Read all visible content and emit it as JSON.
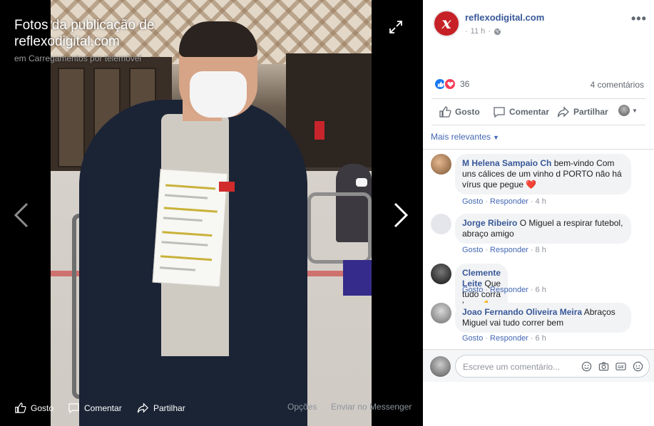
{
  "viewer": {
    "title": "Fotos da publicação de reflexodigital.com",
    "sub_prefix": "em",
    "album": "Carregamentos por telemóvel",
    "bar": {
      "like": "Gosto",
      "comment": "Comentar",
      "share": "Partilhar",
      "options": "Opções",
      "messenger": "Enviar no Messenger"
    }
  },
  "post": {
    "page_name": "reflexodigital.com",
    "avatar_letter": "x",
    "time": "11 h",
    "reaction_count": "36",
    "comments_count": "4 comentários",
    "actions": {
      "like": "Gosto",
      "comment": "Comentar",
      "share": "Partilhar"
    },
    "sort_label": "Mais relevantes"
  },
  "comments": [
    {
      "name": "M Helena Sampaio Ch",
      "text": "bem-vindo Com uns cálices de um vinho d PORTO não há vírus que pegue ❤️",
      "like": "Gosto",
      "reply": "Responder",
      "time": "4 h"
    },
    {
      "name": "Jorge Ribeiro",
      "text": "O Miguel a respirar futebol, abraço amigo",
      "like": "Gosto",
      "reply": "Responder",
      "time": "8 h"
    },
    {
      "name": "Clemente Leite",
      "text": "Que tudo corra bem 💪",
      "like": "Gosto",
      "reply": "Responder",
      "time": "6 h"
    },
    {
      "name": "Joao Fernando Oliveira Meira",
      "text": "Abraços Miguel vai tudo correr bem",
      "like": "Gosto",
      "reply": "Responder",
      "time": "6 h"
    }
  ],
  "composer": {
    "placeholder": "Escreve um comentário...",
    "gif": "GIF"
  },
  "colors": {
    "link": "#385898",
    "accent": "#4267b2",
    "brand_red": "#c62127",
    "like_blue": "#1877f2",
    "love_red": "#f33e58"
  }
}
